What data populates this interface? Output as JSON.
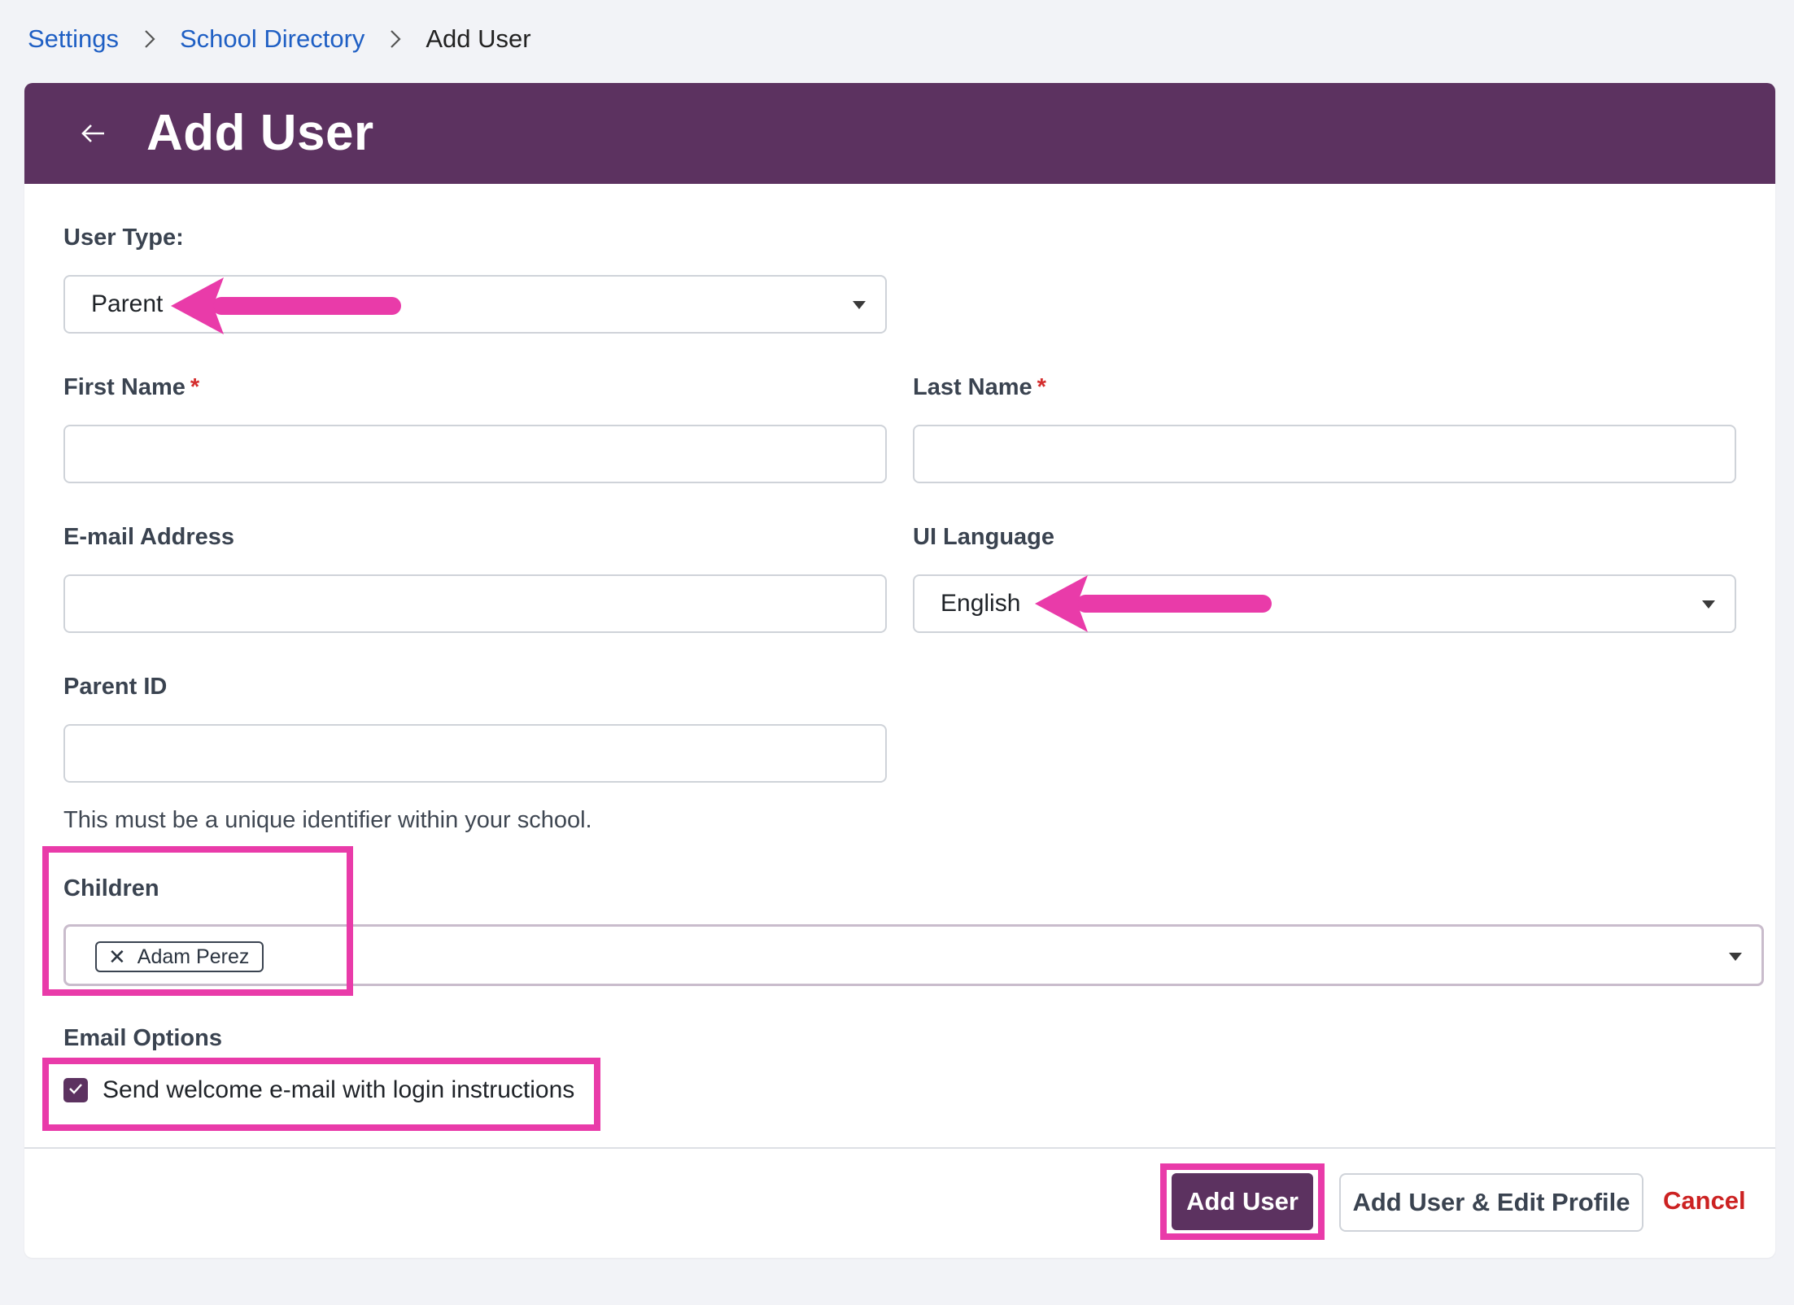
{
  "breadcrumb": {
    "items": [
      "Settings",
      "School Directory"
    ],
    "current": "Add User"
  },
  "header": {
    "title": "Add User"
  },
  "form": {
    "user_type": {
      "label": "User Type:",
      "value": "Parent"
    },
    "first_name": {
      "label": "First Name",
      "required_mark": "*",
      "value": ""
    },
    "last_name": {
      "label": "Last Name",
      "required_mark": "*",
      "value": ""
    },
    "email": {
      "label": "E-mail Address",
      "value": ""
    },
    "ui_language": {
      "label": "UI Language",
      "value": "English"
    },
    "parent_id": {
      "label": "Parent ID",
      "value": "",
      "helper": "This must be a unique identifier within your school."
    },
    "children": {
      "label": "Children",
      "chips": [
        "Adam Perez"
      ]
    },
    "email_options": {
      "label": "Email Options",
      "welcome_checkbox": {
        "label": "Send welcome e-mail with login instructions",
        "checked": true
      }
    }
  },
  "actions": {
    "add_user": "Add User",
    "add_user_edit_profile": "Add User & Edit Profile",
    "cancel": "Cancel"
  },
  "colors": {
    "brand": "#5c3260",
    "annotation": "#e93ba9",
    "link": "#1f5fc4",
    "danger": "#cc2222"
  },
  "icons": [
    "arrow-left-icon",
    "chevron-right-icon",
    "caret-down-icon",
    "close-icon",
    "checkmark-icon"
  ]
}
